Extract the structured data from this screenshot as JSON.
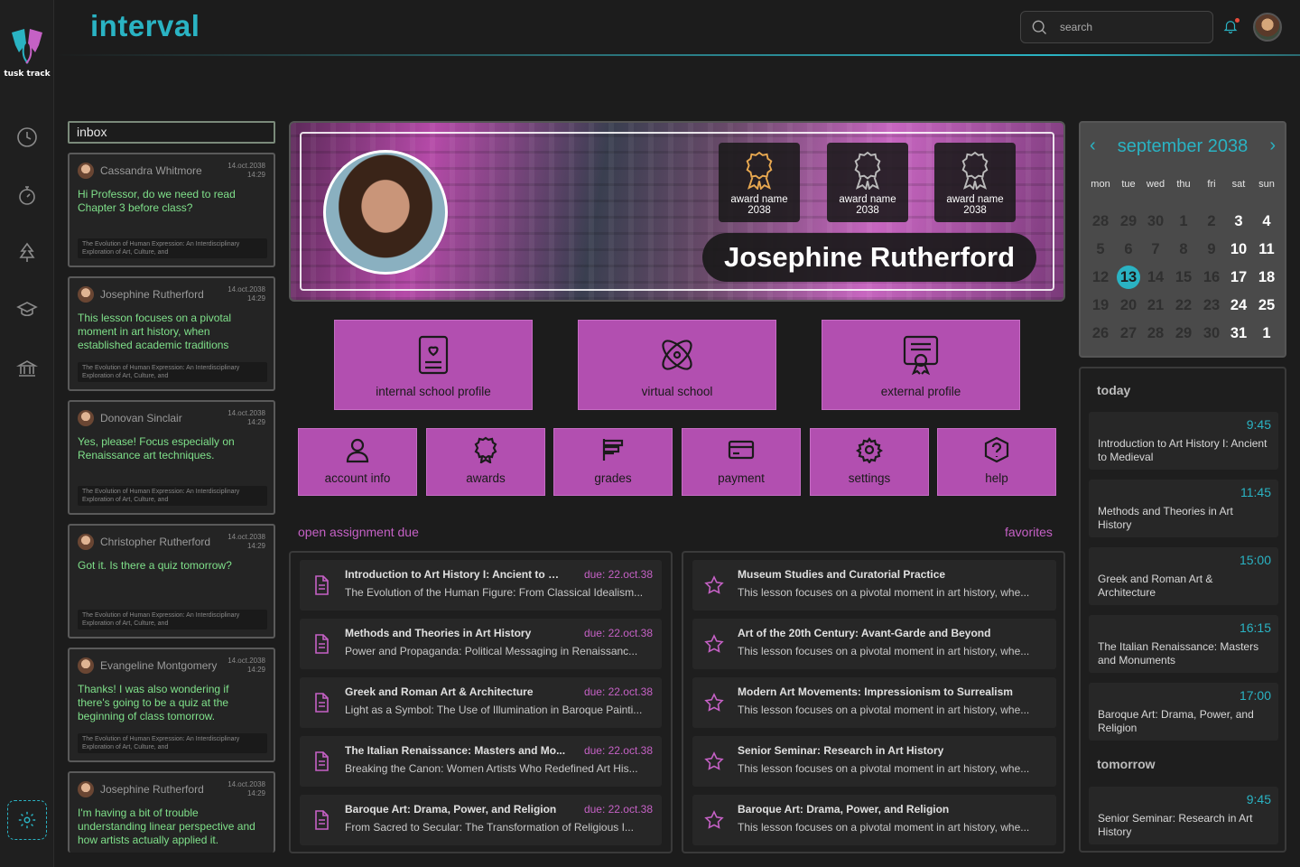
{
  "app": {
    "title": "interval",
    "logo_text": "tusk track"
  },
  "header": {
    "search_placeholder": "search"
  },
  "inbox": {
    "title": "inbox",
    "messages": [
      {
        "name": "Cassandra Whitmore",
        "date": "14.oct.2038",
        "time": "14:29",
        "text": "Hi Professor, do we need to read Chapter 3 before class?",
        "subject": "The Evolution of Human Expression: An Interdisciplinary Exploration of Art, Culture, and"
      },
      {
        "name": "Josephine Rutherford",
        "date": "14.oct.2038",
        "time": "14:29",
        "text": "This lesson focuses on a pivotal moment in art history, when established academic traditions",
        "subject": "The Evolution of Human Expression: An Interdisciplinary Exploration of Art, Culture, and"
      },
      {
        "name": "Donovan Sinclair",
        "date": "14.oct.2038",
        "time": "14:29",
        "text": "Yes, please! Focus especially on Renaissance art techniques.",
        "subject": "The Evolution of Human Expression: An Interdisciplinary Exploration of Art, Culture, and"
      },
      {
        "name": "Christopher Rutherford",
        "date": "14.oct.2038",
        "time": "14:29",
        "text": "Got it. Is there a quiz tomorrow?",
        "subject": "The Evolution of Human Expression: An Interdisciplinary Exploration of Art, Culture, and"
      },
      {
        "name": "Evangeline Montgomery",
        "date": "14.oct.2038",
        "time": "14:29",
        "text": "Thanks! I was also wondering if there's going to be a quiz at the beginning of class tomorrow.",
        "subject": "The Evolution of Human Expression: An Interdisciplinary Exploration of Art, Culture, and"
      },
      {
        "name": "Josephine Rutherford",
        "date": "14.oct.2038",
        "time": "14:29",
        "text": "I'm having a bit of trouble understanding linear perspective and how artists actually applied it.",
        "subject": ""
      }
    ]
  },
  "profile": {
    "name": "Josephine Rutherford",
    "awards": [
      {
        "label": "award name",
        "year": "2038"
      },
      {
        "label": "award name",
        "year": "2038"
      },
      {
        "label": "award name",
        "year": "2038"
      }
    ]
  },
  "tiles_big": [
    {
      "label": "internal school profile",
      "icon": "id-card-icon"
    },
    {
      "label": "virtual school",
      "icon": "atom-icon"
    },
    {
      "label": "external profile",
      "icon": "certificate-icon"
    }
  ],
  "tiles_small": [
    {
      "label": "account info",
      "icon": "user-icon"
    },
    {
      "label": "awards",
      "icon": "award-icon"
    },
    {
      "label": "grades",
      "icon": "grades-icon"
    },
    {
      "label": "payment",
      "icon": "card-icon"
    },
    {
      "label": "settings",
      "icon": "gear-icon"
    },
    {
      "label": "help",
      "icon": "help-icon"
    }
  ],
  "assignments": {
    "title": "open assignment due",
    "items": [
      {
        "title": "Introduction to Art History I: Ancient to M...",
        "due": "due: 22.oct.38",
        "sub": "The Evolution of the Human Figure: From Classical Idealism..."
      },
      {
        "title": "Methods and Theories in Art History",
        "due": "due: 22.oct.38",
        "sub": "Power and Propaganda: Political Messaging in Renaissanc..."
      },
      {
        "title": "Greek and Roman Art & Architecture",
        "due": "due: 22.oct.38",
        "sub": "Light as a Symbol: The Use of Illumination in Baroque Painti..."
      },
      {
        "title": "The Italian Renaissance: Masters and Mo...",
        "due": "due: 22.oct.38",
        "sub": "Breaking the Canon: Women Artists Who Redefined Art His..."
      },
      {
        "title": "Baroque Art: Drama, Power, and Religion",
        "due": "due: 22.oct.38",
        "sub": "From Sacred to Secular: The Transformation of Religious I..."
      }
    ]
  },
  "favorites": {
    "title": "favorites",
    "items": [
      {
        "title": "Museum Studies and Curatorial Practice",
        "sub": "This lesson focuses on a pivotal moment in art history, whe..."
      },
      {
        "title": "Art of the 20th Century: Avant-Garde and Beyond",
        "sub": "This lesson focuses on a pivotal moment in art history, whe..."
      },
      {
        "title": "Modern Art Movements: Impressionism to Surrealism",
        "sub": "This lesson focuses on a pivotal moment in art history, whe..."
      },
      {
        "title": "Senior Seminar: Research in Art History",
        "sub": "This lesson focuses on a pivotal moment in art history, whe..."
      },
      {
        "title": "Baroque Art: Drama, Power, and Religion",
        "sub": "This lesson focuses on a pivotal moment in art history, whe..."
      }
    ]
  },
  "calendar": {
    "title": "september 2038",
    "days_of_week": [
      "mon",
      "tue",
      "wed",
      "thu",
      "fri",
      "sat",
      "sun"
    ],
    "weeks": [
      [
        "28",
        "29",
        "30",
        "1",
        "2",
        "3",
        "4"
      ],
      [
        "5",
        "6",
        "7",
        "8",
        "9",
        "10",
        "11"
      ],
      [
        "12",
        "13",
        "14",
        "15",
        "16",
        "17",
        "18"
      ],
      [
        "19",
        "20",
        "21",
        "22",
        "23",
        "24",
        "25"
      ],
      [
        "26",
        "27",
        "28",
        "29",
        "30",
        "31",
        "1"
      ]
    ],
    "today": "13"
  },
  "schedule": {
    "today_label": "today",
    "today": [
      {
        "time": "9:45",
        "title": "Introduction to Art History I: Ancient to Medieval"
      },
      {
        "time": "11:45",
        "title": "Methods and Theories in Art History"
      },
      {
        "time": "15:00",
        "title": "Greek and Roman Art & Architecture"
      },
      {
        "time": "16:15",
        "title": "The Italian Renaissance: Masters and Monuments"
      },
      {
        "time": "17:00",
        "title": "Baroque Art: Drama, Power, and Religion"
      }
    ],
    "tomorrow_label": "tomorrow",
    "tomorrow": [
      {
        "time": "9:45",
        "title": "Senior Seminar: Research in Art History"
      }
    ]
  },
  "colors": {
    "accent": "#2ab3c3",
    "tile": "#b24fb0",
    "highlight": "#c561c5",
    "message_text": "#7fe08a"
  }
}
